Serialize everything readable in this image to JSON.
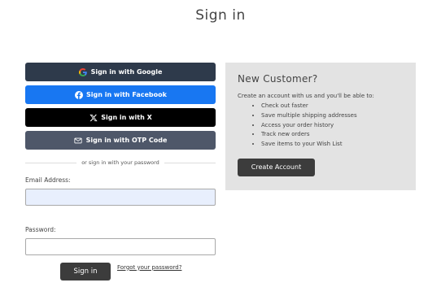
{
  "page": {
    "title": "Sign in"
  },
  "sso": {
    "google": "Sign in with Google",
    "facebook": "Sign in with Facebook",
    "x": "Sign in with X",
    "otp": "Sign in with OTP Code"
  },
  "divider": "or sign in with your password",
  "form": {
    "email_label": "Email Address:",
    "email_value": "",
    "password_label": "Password:",
    "password_value": "",
    "submit": "Sign in",
    "forgot": "Forgot your password?"
  },
  "new_customer": {
    "title": "New Customer?",
    "intro": "Create an account with us and you'll be able to:",
    "benefits": [
      "Check out faster",
      "Save multiple shipping addresses",
      "Access your order history",
      "Track new orders",
      "Save items to your Wish List"
    ],
    "button": "Create Account"
  },
  "colors": {
    "google_button": "#2e3a4b",
    "facebook_button": "#1877f2",
    "x_button": "#000000",
    "otp_button": "#4e5769",
    "dark_button": "#3c3c3c",
    "panel_bg": "#e3e3e3",
    "email_input_bg": "#e8effd"
  },
  "icons": {
    "google": "google-icon",
    "facebook": "facebook-icon",
    "x": "x-logo-icon",
    "otp": "mail-icon"
  }
}
